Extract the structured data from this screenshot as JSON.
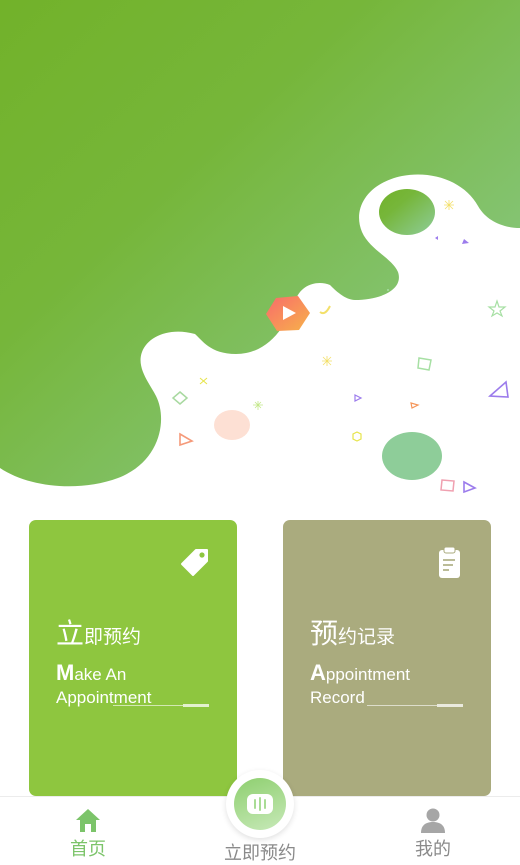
{
  "cards": [
    {
      "title_first": "立",
      "title_rest": "即预约",
      "en_first": "M",
      "en_rest_line1": "ake An",
      "en_line2": "Appointment",
      "icon": "tag-icon",
      "color": "#8ec63f"
    },
    {
      "title_first": "预",
      "title_rest": "约记录",
      "en_first": "A",
      "en_rest_line1": "ppointment",
      "en_line2": "Record",
      "icon": "clipboard-icon",
      "color": "#aaab7e"
    }
  ],
  "tabbar": {
    "items": [
      {
        "label": "首页",
        "icon": "home-icon",
        "active": true
      },
      {
        "label": "立即预约",
        "icon": "appointment-icon",
        "active": false
      },
      {
        "label": "我的",
        "icon": "user-icon",
        "active": false
      }
    ],
    "active_color": "#7cc46a",
    "inactive_color": "#8a8a8a"
  },
  "hero": {
    "play_icon": "play-icon",
    "gradient_from": "#76b52f",
    "gradient_to": "#8dcc95"
  }
}
